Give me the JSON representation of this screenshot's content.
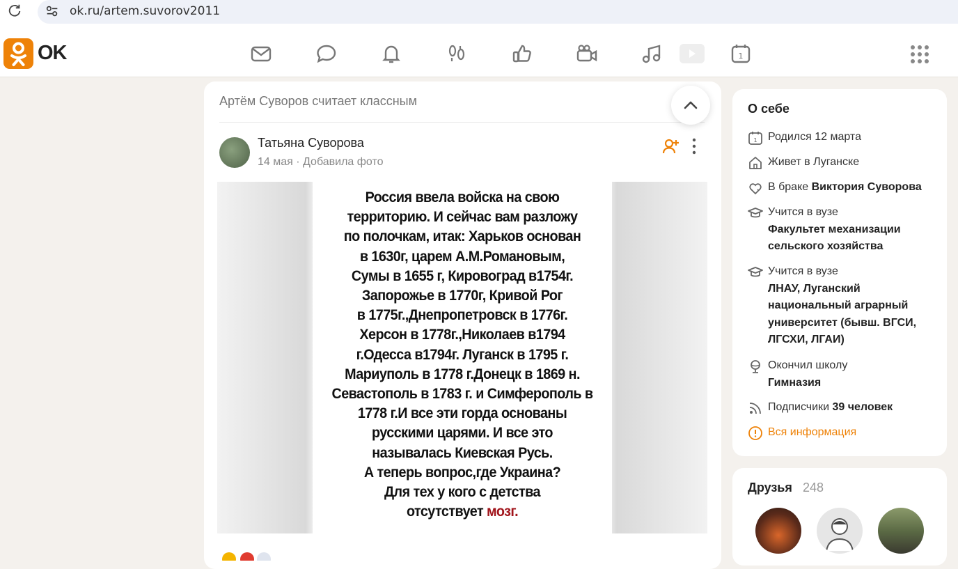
{
  "browser": {
    "url": "ok.ru/artem.suvorov2011"
  },
  "header": {
    "logo_text": "OK",
    "nav_icons": [
      "envelope-icon",
      "chat-icon",
      "bell-icon",
      "footprints-icon",
      "thumbs-up-icon",
      "video-camera-icon",
      "music-icon",
      "play-icon",
      "calendar-icon"
    ]
  },
  "feed": {
    "heading": "Артём Суворов считает классным",
    "post": {
      "author": "Татьяна Суворова",
      "meta": "14 мая · Добавила фото",
      "image_lines": [
        "Россия ввела войска на свою",
        "территорию. И сейчас вам разложу",
        "по полочкам, итак: Харьков основан",
        "в 1630г, царем А.М.Романовым,",
        "Сумы в 1655 г, Кировоград в1754г.",
        "Запорожье в 1770г, Кривой Рог",
        "в 1775г.,Днепропетровск в 1776г.",
        "Херсон в 1778г.,Николаев в1794",
        "г.Одесса в1794г. Луганск в 1795 г.",
        "Мариуполь в 1778 г.Донецк в 1869 н.",
        "Севастополь в 1783 г. и Симферополь в",
        "1778 г.И все эти горда основаны",
        "русскими царями. И все это",
        "называлась Киевская Русь.",
        "А теперь вопрос,где Украина?",
        "Для тех у кого с детства"
      ],
      "image_last_line_prefix": "отсутствует ",
      "image_last_line_red": "мозг.",
      "accent_red": "#a1141b"
    }
  },
  "about": {
    "title": "О себе",
    "born": "Родился 12 марта",
    "lives": "Живет в Луганске",
    "married_prefix": "В браке ",
    "married_name": "Виктория Суворова",
    "study1_label": "Учится в вузе",
    "study1_value": "Факультет механизации сельского хозяйства",
    "study2_label": "Учится в вузе",
    "study2_value": "ЛНАУ, Луганский национальный аграрный университет (бывш. ВГСИ, ЛГСХИ, ЛГАИ)",
    "school_label": "Окончил школу",
    "school_value": "Гимназия",
    "subs_prefix": "Подписчики ",
    "subs_value": "39 человек",
    "all_info": "Вся информация"
  },
  "friends": {
    "title": "Друзья",
    "count": "248"
  },
  "colors": {
    "brand_orange": "#ee8208",
    "page_bg": "#f4f1ed"
  }
}
